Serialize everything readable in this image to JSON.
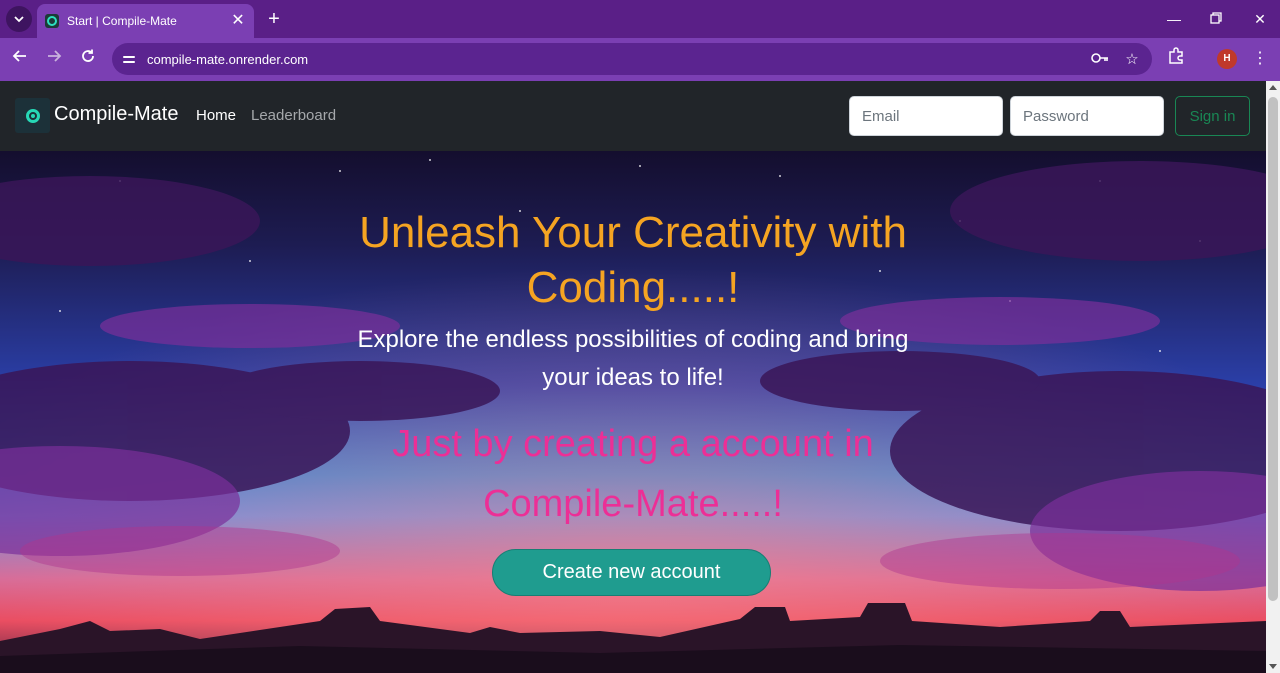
{
  "browser": {
    "tab": {
      "title": "Start | Compile-Mate"
    },
    "url": "compile-mate.onrender.com",
    "profile_initial": "H",
    "icons": {
      "tab_menu": "chevron-down-icon",
      "new_tab": "plus-icon",
      "back": "arrow-left-icon",
      "forward": "arrow-right-icon",
      "reload": "reload-icon",
      "site_info": "tune-icon",
      "password": "key-icon",
      "bookmark": "star-icon",
      "extensions": "puzzle-icon",
      "menu": "kebab-icon"
    }
  },
  "navbar": {
    "brand": "Compile-Mate",
    "links": [
      {
        "label": "Home",
        "active": true
      },
      {
        "label": "Leaderboard",
        "active": false
      }
    ],
    "email_placeholder": "Email",
    "password_placeholder": "Password",
    "signin_label": "Sign in"
  },
  "hero": {
    "title_line1": "Unleash Your Creativity with",
    "title_line2": "Coding.....!",
    "subtitle_line1": "Explore the endless possibilities of coding and bring",
    "subtitle_line2": "your ideas to life!",
    "cta_line1": "Just by creating a account in",
    "cta_line2": "Compile-Mate.....!",
    "button_label": "Create new account"
  },
  "colors": {
    "tabbar": "#5a1f87",
    "toolbar": "#7b3fb3",
    "navbar": "#212529",
    "title": "#f5a422",
    "cta": "#ec2f96",
    "button": "#1f9c8f",
    "signin": "#198754"
  }
}
